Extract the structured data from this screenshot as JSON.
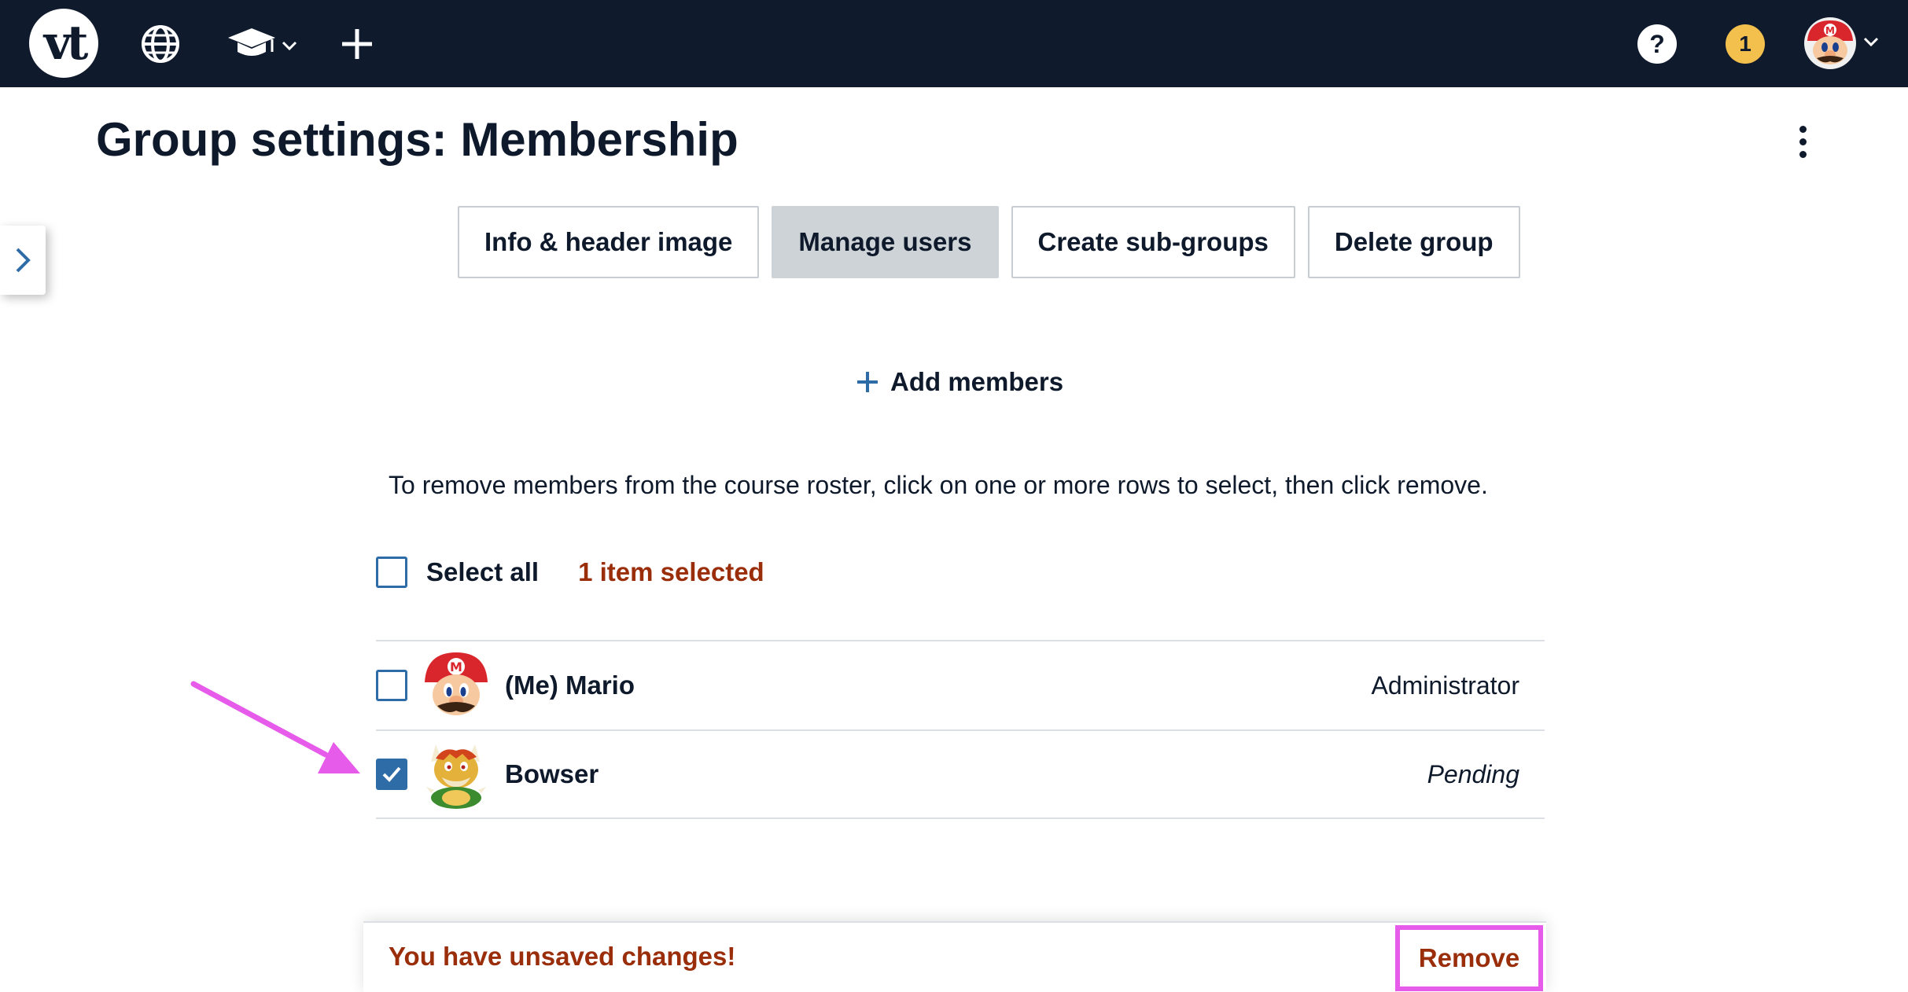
{
  "topbar": {
    "logo_text": "vt",
    "icons": [
      "globe-icon",
      "graduation-cap-icon",
      "plus-icon",
      "help-icon",
      "user-avatar"
    ],
    "help_label": "?",
    "notification_count": "1"
  },
  "header": {
    "title": "Group settings: Membership"
  },
  "tabs": [
    {
      "label": "Info & header image",
      "active": false
    },
    {
      "label": "Manage users",
      "active": true
    },
    {
      "label": "Create sub-groups",
      "active": false
    },
    {
      "label": "Delete group",
      "active": false
    }
  ],
  "add_members": {
    "label": "Add members"
  },
  "instructions": "To remove members from the course roster, click on one or more rows to select, then click remove.",
  "selection": {
    "select_all_label": "Select all",
    "selected_count_label": "1 item selected",
    "select_all_checked": false
  },
  "members": [
    {
      "name": "(Me) Mario",
      "role": "Administrator",
      "checked": false
    },
    {
      "name": "Bowser",
      "role": "Pending",
      "checked": true
    }
  ],
  "footer": {
    "unsaved_label": "You have unsaved changes!",
    "remove_label": "Remove"
  },
  "colors": {
    "topbar": "#0f1a2c",
    "accent_blue": "#2e6ca8",
    "warning_text": "#9a2e0b",
    "notification_badge": "#f4c04d",
    "annotation_highlight": "#e65bea"
  }
}
